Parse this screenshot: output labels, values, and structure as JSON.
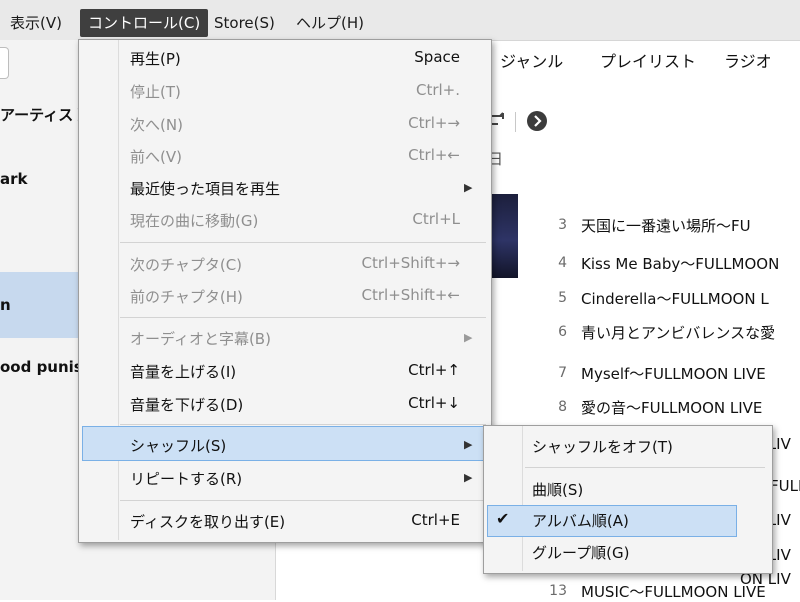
{
  "menubar": {
    "items": [
      {
        "label": "表示(V)",
        "active": false
      },
      {
        "label": "コントロール(C)",
        "active": true
      },
      {
        "label": "Store(S)",
        "active": false
      },
      {
        "label": "ヘルプ(H)",
        "active": false
      }
    ]
  },
  "sidebar": {
    "items": [
      {
        "label": "アーティスト"
      },
      {
        "label": "ark"
      },
      {
        "label": "n"
      },
      {
        "label": "ood punis"
      }
    ]
  },
  "tabs": [
    "ジャンル",
    "プレイリスト",
    "ラジオ"
  ],
  "toolbar": {
    "shuffle_icon": "shuffle-icon",
    "forward_icon": "forward-circle-icon",
    "partial_text": "日"
  },
  "tracks": [
    {
      "num": "3",
      "title": "天国に一番遠い場所〜FU"
    },
    {
      "num": "4",
      "title": "Kiss Me Baby〜FULLMOON"
    },
    {
      "num": "5",
      "title": "Cinderella〜FULLMOON L"
    },
    {
      "num": "6",
      "title": "青い月とアンビバレンスな愛"
    },
    {
      "num": "7",
      "title": "Myself〜FULLMOON LIVE"
    },
    {
      "num": "8",
      "title": "愛の音〜FULLMOON LIVE"
    },
    {
      "num": "",
      "title": "ON LIV"
    },
    {
      "num": "",
      "title": "ィ〜FULL"
    },
    {
      "num": "",
      "title": "ON LIV"
    },
    {
      "num": "",
      "title": "ON LIV"
    },
    {
      "num": "",
      "title": "ON LIV"
    },
    {
      "num": "13",
      "title": "MUSIC〜FULLMOON LIVE"
    }
  ],
  "control_menu": {
    "items": [
      {
        "label": "再生(P)",
        "shortcut": "Space",
        "enabled": true
      },
      {
        "label": "停止(T)",
        "shortcut": "Ctrl+.",
        "enabled": false
      },
      {
        "label": "次へ(N)",
        "shortcut": "Ctrl+→",
        "enabled": false
      },
      {
        "label": "前へ(V)",
        "shortcut": "Ctrl+←",
        "enabled": false
      },
      {
        "label": "最近使った項目を再生",
        "shortcut": "",
        "enabled": true,
        "submenu": true
      },
      {
        "label": "現在の曲に移動(G)",
        "shortcut": "Ctrl+L",
        "enabled": false
      },
      {
        "label": "次のチャプタ(C)",
        "shortcut": "Ctrl+Shift+→",
        "enabled": false
      },
      {
        "label": "前のチャプタ(H)",
        "shortcut": "Ctrl+Shift+←",
        "enabled": false
      },
      {
        "label": "オーディオと字幕(B)",
        "shortcut": "",
        "enabled": false,
        "submenu": true
      },
      {
        "label": "音量を上げる(I)",
        "shortcut": "Ctrl+↑",
        "enabled": true
      },
      {
        "label": "音量を下げる(D)",
        "shortcut": "Ctrl+↓",
        "enabled": true
      },
      {
        "label": "シャッフル(S)",
        "shortcut": "",
        "enabled": true,
        "submenu": true,
        "highlighted": true
      },
      {
        "label": "リピートする(R)",
        "shortcut": "",
        "enabled": true,
        "submenu": true
      },
      {
        "label": "ディスクを取り出す(E)",
        "shortcut": "Ctrl+E",
        "enabled": true
      }
    ]
  },
  "shuffle_submenu": {
    "items": [
      {
        "label": "シャッフルをオフ(T)",
        "checked": false
      },
      {
        "label": "曲順(S)",
        "checked": false
      },
      {
        "label": "アルバム順(A)",
        "checked": true,
        "highlighted": true
      },
      {
        "label": "グループ順(G)",
        "checked": false
      }
    ],
    "check_glyph": "✔"
  },
  "colors": {
    "menubar_bg": "#e9e9e9",
    "active_menu_bg": "#3f3f3f",
    "highlight_bg": "#cce0f5",
    "highlight_border": "#7ab0e6",
    "sidebar_selected": "#c7d9ee"
  }
}
